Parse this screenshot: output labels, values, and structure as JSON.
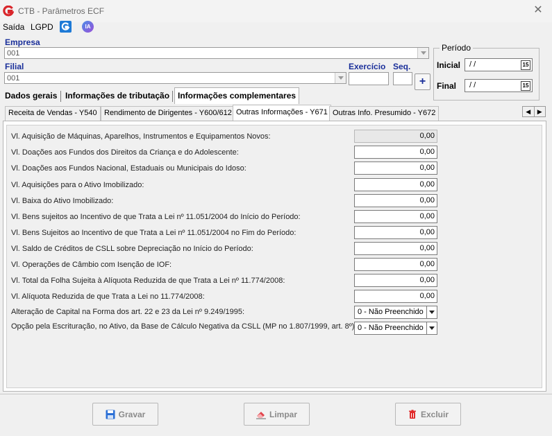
{
  "window": {
    "title": "CTB - Parâmetros ECF",
    "close_glyph": "✕"
  },
  "menu": {
    "items": [
      {
        "label": "Saída"
      },
      {
        "label": "LGPD"
      }
    ],
    "icons": [
      "g-brand-icon",
      "ia-badge-icon"
    ],
    "ia_text": "IA"
  },
  "empresa": {
    "label": "Empresa",
    "value": "001"
  },
  "filial": {
    "label": "Filial",
    "value": "001"
  },
  "exercicio": {
    "label": "Exercício",
    "value": ""
  },
  "seq": {
    "label": "Seq.",
    "value": ""
  },
  "add_button": {
    "label": "+"
  },
  "periodo": {
    "legend": "Período",
    "inicial": {
      "label": "Inicial",
      "value": "/ /"
    },
    "final": {
      "label": "Final",
      "value": "/ /"
    },
    "calendar_glyph": "15"
  },
  "main_tabs": [
    {
      "label": "Dados gerais",
      "active": false
    },
    {
      "label": "Informações de tributação",
      "active": false
    },
    {
      "label": "Informações complementares",
      "active": true
    }
  ],
  "inner_tabs": [
    {
      "label": "Receita de Vendas - Y540",
      "active": false
    },
    {
      "label": "Rendimento de Dirigentes - Y600/612",
      "active": false
    },
    {
      "label": "Outras Informações - Y671",
      "active": true
    },
    {
      "label": "Outras Info. Presumido - Y672",
      "active": false
    }
  ],
  "tab_scroll": {
    "left": "◀",
    "right": "▶"
  },
  "rows": [
    {
      "label": "Vl. Aquisição de Máquinas, Aparelhos, Instrumentos e Equipamentos Novos:",
      "value": "0,00",
      "disabled": true
    },
    {
      "label": "Vl. Doações aos Fundos dos Direitos da Criança e do Adolescente:",
      "value": "0,00"
    },
    {
      "label": "Vl. Doações aos Fundos Nacional, Estaduais ou Municipais do Idoso:",
      "value": "0,00"
    },
    {
      "label": "Vl. Aquisições para o Ativo Imobilizado:",
      "value": "0,00"
    },
    {
      "label": "Vl. Baixa do Ativo Imobilizado:",
      "value": "0,00"
    },
    {
      "label": "Vl. Bens sujeitos ao Incentivo de que Trata a Lei nº 11.051/2004 do Início do Período:",
      "value": "0,00"
    },
    {
      "label": "Vl. Bens Sujeitos ao Incentivo de que Trata a Lei nº 11.051/2004 no Fim do Período:",
      "value": "0,00"
    },
    {
      "label": "Vl. Saldo de Créditos de CSLL sobre Depreciação no Início do Período:",
      "value": "0,00"
    },
    {
      "label": "Vl. Operações de Câmbio com Isenção de IOF:",
      "value": "0,00"
    },
    {
      "label": "Vl. Total da Folha Sujeita à Alíquota Reduzida de que Trata a Lei nº 11.774/2008:",
      "value": "0,00"
    },
    {
      "label": "Vl. Alíquota Reduzida de que Trata a Lei no 11.774/2008:",
      "value": "0,00"
    }
  ],
  "selects": [
    {
      "label": "Alteração de Capital na Forma dos art. 22 e 23 da Lei nº 9.249/1995:",
      "value": "0 - Não Preenchido"
    },
    {
      "label": "Opção pela Escrituração, no Ativo, da Base de Cálculo Negativa da CSLL (MP no 1.807/1999, art. 8º)",
      "value": "0 - Não Preenchido"
    }
  ],
  "buttons": {
    "gravar": "Gravar",
    "limpar": "Limpar",
    "excluir": "Excluir"
  },
  "colors": {
    "accent_blue": "#1a2f9a",
    "brand_red": "#d9262b",
    "g_icon_blue": "#1e7ad6",
    "ia_purple": "#7a55d9"
  }
}
